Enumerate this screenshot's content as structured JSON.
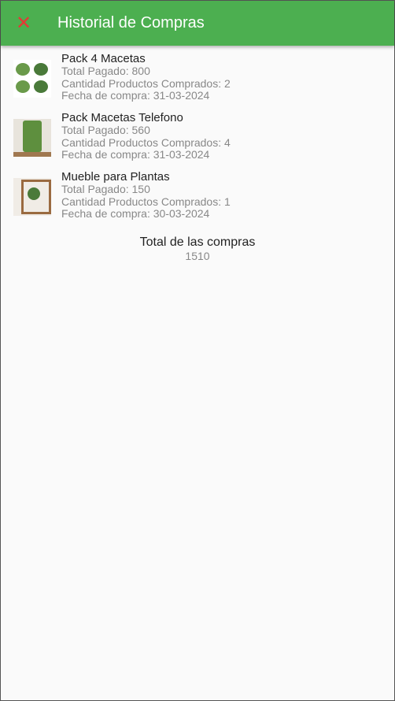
{
  "header": {
    "title": "Historial de Compras",
    "close_icon": "close-icon"
  },
  "items": [
    {
      "name": "Pack 4 Macetas",
      "paid": "Total Pagado: 800",
      "qty": "Cantidad Productos Comprados: 2",
      "date": "Fecha de compra: 31-03-2024"
    },
    {
      "name": "Pack Macetas Telefono",
      "paid": "Total Pagado: 560",
      "qty": "Cantidad Productos Comprados: 4",
      "date": "Fecha de compra: 31-03-2024"
    },
    {
      "name": "Mueble para Plantas",
      "paid": "Total Pagado: 150",
      "qty": "Cantidad Productos Comprados: 1",
      "date": "Fecha de compra: 30-03-2024"
    }
  ],
  "summary": {
    "label": "Total de las compras",
    "value": "1510"
  }
}
